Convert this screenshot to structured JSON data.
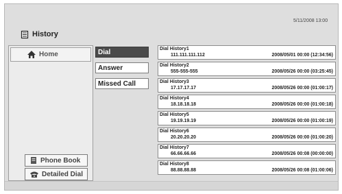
{
  "status": {
    "datetime": "5/11/2008 13:00"
  },
  "header": {
    "title": "History",
    "icon": "folder-icon"
  },
  "nav": {
    "home_label": "Home",
    "phone_book_label": "Phone Book",
    "detailed_dial_label": "Detailed Dial"
  },
  "tabs": [
    {
      "label": "Dial",
      "selected": true
    },
    {
      "label": "Answer",
      "selected": false
    },
    {
      "label": "Missed Call",
      "selected": false
    }
  ],
  "history": [
    {
      "name": "Dial History1",
      "number": "111.111.111.112",
      "datetime": "2008/05/01 00:00 (12:34:56)"
    },
    {
      "name": "Dial History2",
      "number": "555-555-555",
      "datetime": "2008/05/26 00:00 (03:25:45)"
    },
    {
      "name": "Dial History3",
      "number": "17.17.17.17",
      "datetime": "2008/05/26 00:00 (01:00:17)"
    },
    {
      "name": "Dial History4",
      "number": "18.18.18.18",
      "datetime": "2008/05/26 00:00 (01:00:18)"
    },
    {
      "name": "Dial History5",
      "number": "19.19.19.19",
      "datetime": "2008/05/26 00:00 (01:00:19)"
    },
    {
      "name": "Dial History6",
      "number": "20.20.20.20",
      "datetime": "2008/05/26 00:00 (01:00:20)"
    },
    {
      "name": "Dial History7",
      "number": "66.66.66.66",
      "datetime": "2008/05/26 00:08 (00:00:00)"
    },
    {
      "name": "Dial History8",
      "number": "88.88.88.88",
      "datetime": "2008/05/26 00:08 (01:00:06)"
    }
  ]
}
